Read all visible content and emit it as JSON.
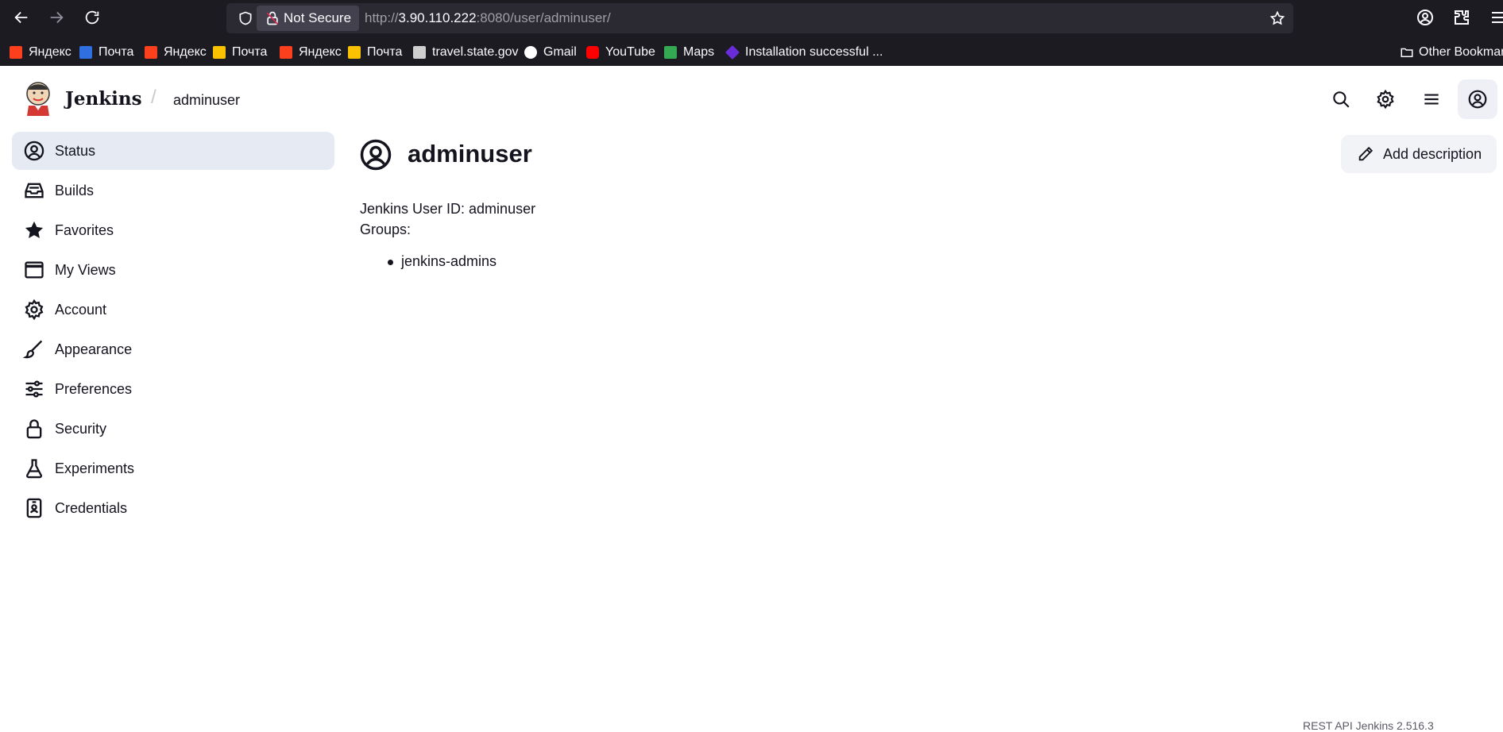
{
  "browser": {
    "not_secure_label": "Not Secure",
    "url_scheme": "http://",
    "url_host": "3.90.110.222",
    "url_rest": ":8080/user/adminuser/",
    "bookmarks": [
      {
        "label": "Яндекс",
        "icon": "yandex-icon",
        "color": "#fc3f1d"
      },
      {
        "label": "Почта",
        "icon": "mail-icon",
        "color": "#2f6fe0"
      },
      {
        "label": "Яндекс",
        "icon": "yandex-icon",
        "color": "#fc3f1d"
      },
      {
        "label": "Почта",
        "icon": "yandex-mail-icon",
        "color": "#f8c200"
      },
      {
        "label": "Яндекс",
        "icon": "yandex-icon",
        "color": "#fc3f1d"
      },
      {
        "label": "Почта",
        "icon": "yandex-mail-icon",
        "color": "#f8c200"
      },
      {
        "label": "travel.state.gov",
        "icon": "travel-icon",
        "color": "#cfcfcf"
      },
      {
        "label": "Gmail",
        "icon": "google-icon",
        "color": "#ffffff"
      },
      {
        "label": "YouTube",
        "icon": "youtube-icon",
        "color": "#ff0000"
      },
      {
        "label": "Maps",
        "icon": "maps-icon",
        "color": "#34a853"
      },
      {
        "label": "Installation successful ...",
        "icon": "install-icon",
        "color": "#6a2bd9"
      }
    ],
    "other_bookmarks": "Other Bookmarks"
  },
  "header": {
    "brand": "Jenkins",
    "breadcrumb_sep": "/",
    "breadcrumb": "adminuser"
  },
  "sidebar": {
    "items": [
      {
        "label": "Status",
        "icon": "user-circle-icon"
      },
      {
        "label": "Builds",
        "icon": "inbox-icon"
      },
      {
        "label": "Favorites",
        "icon": "star-icon"
      },
      {
        "label": "My Views",
        "icon": "window-icon"
      },
      {
        "label": "Account",
        "icon": "gear-icon"
      },
      {
        "label": "Appearance",
        "icon": "brush-icon"
      },
      {
        "label": "Preferences",
        "icon": "sliders-icon"
      },
      {
        "label": "Security",
        "icon": "lock-icon"
      },
      {
        "label": "Experiments",
        "icon": "flask-icon"
      },
      {
        "label": "Credentials",
        "icon": "id-card-icon"
      }
    ]
  },
  "main": {
    "title": "adminuser",
    "add_description": "Add description",
    "user_id_line": "Jenkins User ID: adminuser",
    "groups_label": "Groups:",
    "groups": [
      "jenkins-admins"
    ]
  },
  "footer": {
    "text": "REST API    Jenkins 2.516.3"
  },
  "colors": {
    "browser_bg": "#1c1b22",
    "urlbar_bg": "#2b2a33",
    "sidebar_active": "#e6eaf3",
    "button_bg": "#f2f3f6"
  }
}
